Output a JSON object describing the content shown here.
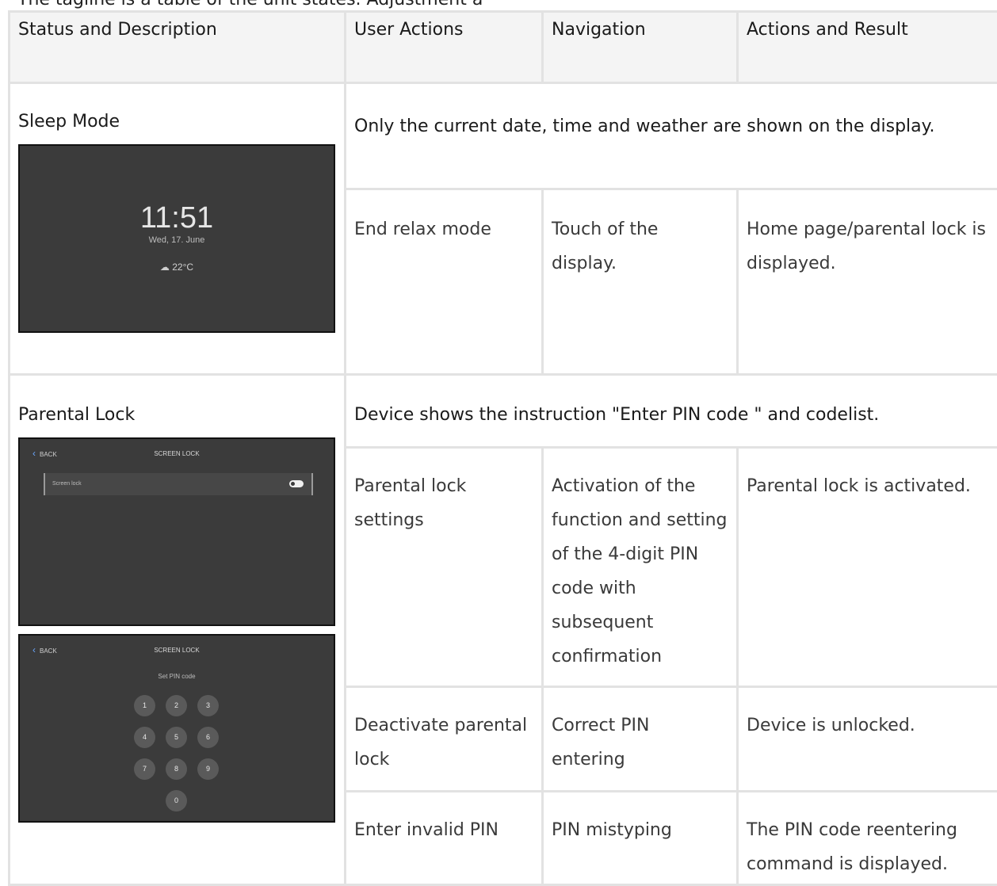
{
  "caption_cut": "The tagline is a table of the unit states. Adjustment a",
  "header": {
    "col1": "Status and Description",
    "col2": "User Actions",
    "col3": "Navigation",
    "col4": "Actions and Result"
  },
  "sleep_mode": {
    "title": "Sleep Mode",
    "description": "Only the current date, time and weather are shown on the display.",
    "screen": {
      "time": "11:51",
      "date": "Wed, 17. June",
      "weather": "☁ 22°C"
    },
    "rows": [
      {
        "action": "End relax mode",
        "navigation": "Touch of the display.",
        "result": "Home page/parental lock is displayed."
      }
    ]
  },
  "parental_lock": {
    "title": "Parental Lock",
    "description": "Device shows the instruction \"Enter PIN code \" and codelist.",
    "screen1": {
      "back": "BACK",
      "title": "SCREEN LOCK",
      "setting": "Screen lock"
    },
    "screen2": {
      "back": "BACK",
      "title": "SCREEN LOCK",
      "pin_label": "Set PIN code",
      "keys": [
        "1",
        "2",
        "3",
        "4",
        "5",
        "6",
        "7",
        "8",
        "9",
        "0"
      ]
    },
    "rows": [
      {
        "action": "Parental lock settings",
        "navigation": "Activation of the function and setting of the 4-digit PIN code with subsequent confirmation",
        "result": "Parental lock is activated."
      },
      {
        "action": "Deactivate parental lock",
        "navigation": "Correct PIN entering",
        "result": "Device is unlocked."
      },
      {
        "action": "Enter invalid PIN",
        "navigation": "PIN mistyping",
        "result": "The PIN code reentering command is displayed."
      }
    ]
  }
}
